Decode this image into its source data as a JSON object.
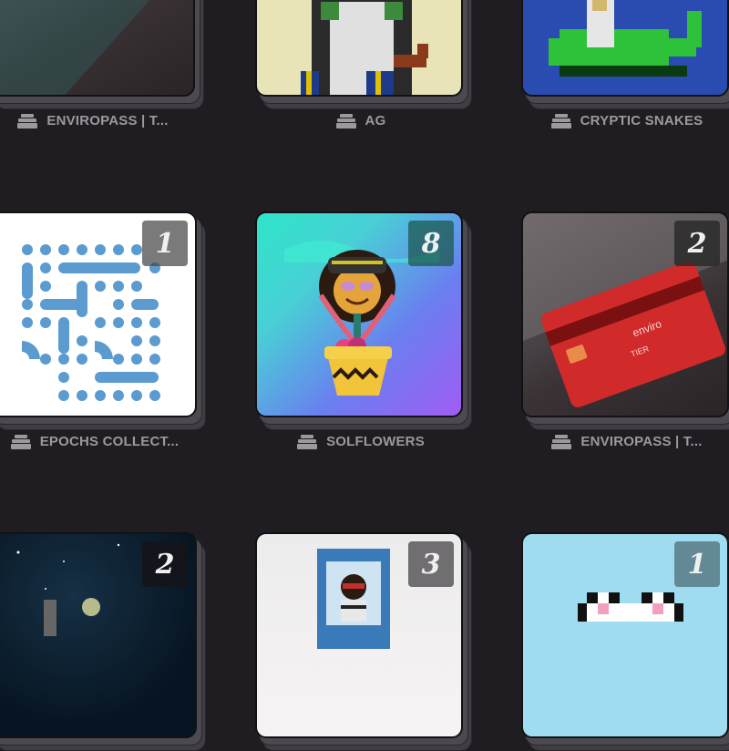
{
  "collections": [
    {
      "name": "ENVIROPASS | T...",
      "count": "",
      "art": "red credit card"
    },
    {
      "name": "AG",
      "count": "",
      "art": "pixel art character with pipe"
    },
    {
      "name": "CRYPTIC SNAKES",
      "count": "",
      "art": "pixel green snake"
    },
    {
      "name": "EPOCHS COLLECT...",
      "count": "1",
      "art": "blue dotted maze pattern"
    },
    {
      "name": "SOLFLOWERS",
      "count": "8",
      "art": "cartoon flower in pot"
    },
    {
      "name": "ENVIROPASS | T...",
      "count": "2",
      "art": "red credit card"
    },
    {
      "name": "",
      "count": "2",
      "art": "night sky scene"
    },
    {
      "name": "",
      "count": "3",
      "art": "character poster"
    },
    {
      "name": "",
      "count": "1",
      "art": "pixel white cat"
    }
  ],
  "card_art": {
    "brand": "enviro",
    "tier": "TIER"
  },
  "colors": {
    "background": "#1f1d21",
    "caption": "#9b989e",
    "badge": "#464646"
  }
}
